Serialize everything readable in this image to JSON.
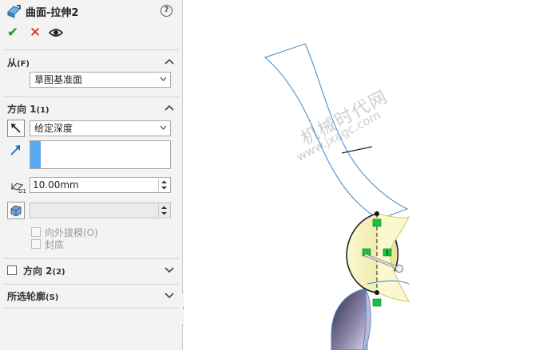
{
  "header": {
    "title": "曲面-拉伸2",
    "help_label": "?"
  },
  "actions": {
    "ok_glyph": "✔",
    "cancel_glyph": "✕"
  },
  "from_section": {
    "title": "从",
    "shortcut": "(F)",
    "selected": "草图基准面"
  },
  "direction1": {
    "title": "方向 1",
    "shortcut": "(1)",
    "end_condition": "给定深度",
    "depth": "10.00mm",
    "draft_outward_label": "向外拔模(O)",
    "cap_label": "封底"
  },
  "direction2": {
    "title": "方向 2",
    "shortcut": "(2)"
  },
  "contours": {
    "title": "所选轮廓",
    "shortcut": "(S)"
  },
  "watermark": {
    "cn": "机械时代网",
    "url": "www.jxagc.com"
  },
  "colors": {
    "panel_bg": "#f3f3f3",
    "accent_blue": "#5aaaf2",
    "ok_green": "#1a9a2b",
    "cancel_red": "#d01c1c",
    "edge_blue": "#3d86c6",
    "preview_yellow": "#f4f0b0",
    "handle_green": "#19c33c"
  }
}
